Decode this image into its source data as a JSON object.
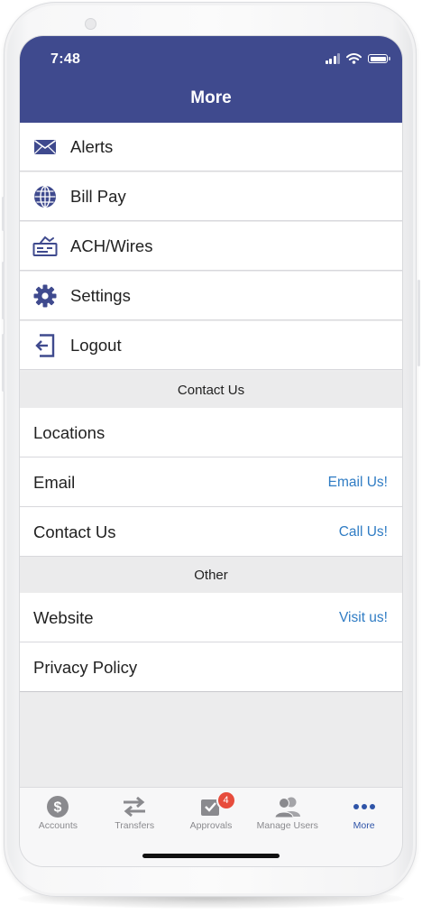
{
  "status_bar": {
    "time": "7:48"
  },
  "header": {
    "title": "More"
  },
  "menu": {
    "items": [
      {
        "label": "Alerts",
        "icon": "envelope-icon"
      },
      {
        "label": "Bill Pay",
        "icon": "globe-icon"
      },
      {
        "label": "ACH/Wires",
        "icon": "check-wire-icon"
      },
      {
        "label": "Settings",
        "icon": "gear-icon"
      },
      {
        "label": "Logout",
        "icon": "logout-icon"
      }
    ]
  },
  "contact": {
    "header": "Contact Us",
    "rows": [
      {
        "label": "Locations",
        "action": ""
      },
      {
        "label": "Email",
        "action": "Email Us!"
      },
      {
        "label": "Contact Us",
        "action": "Call Us!"
      }
    ]
  },
  "other": {
    "header": "Other",
    "rows": [
      {
        "label": "Website",
        "action": "Visit us!"
      },
      {
        "label": "Privacy Policy",
        "action": ""
      }
    ]
  },
  "tab_bar": {
    "tabs": [
      {
        "label": "Accounts",
        "icon": "dollar-circle-icon",
        "active": false
      },
      {
        "label": "Transfers",
        "icon": "transfer-arrows-icon",
        "active": false
      },
      {
        "label": "Approvals",
        "icon": "approval-check-icon",
        "active": false,
        "badge": "4"
      },
      {
        "label": "Manage Users",
        "icon": "users-icon",
        "active": false
      },
      {
        "label": "More",
        "icon": "more-dots-icon",
        "active": true
      }
    ]
  },
  "colors": {
    "header": "#3f4a8e",
    "link": "#2f7cc4",
    "active_tab": "#2f54a8",
    "badge": "#e74c3c"
  }
}
